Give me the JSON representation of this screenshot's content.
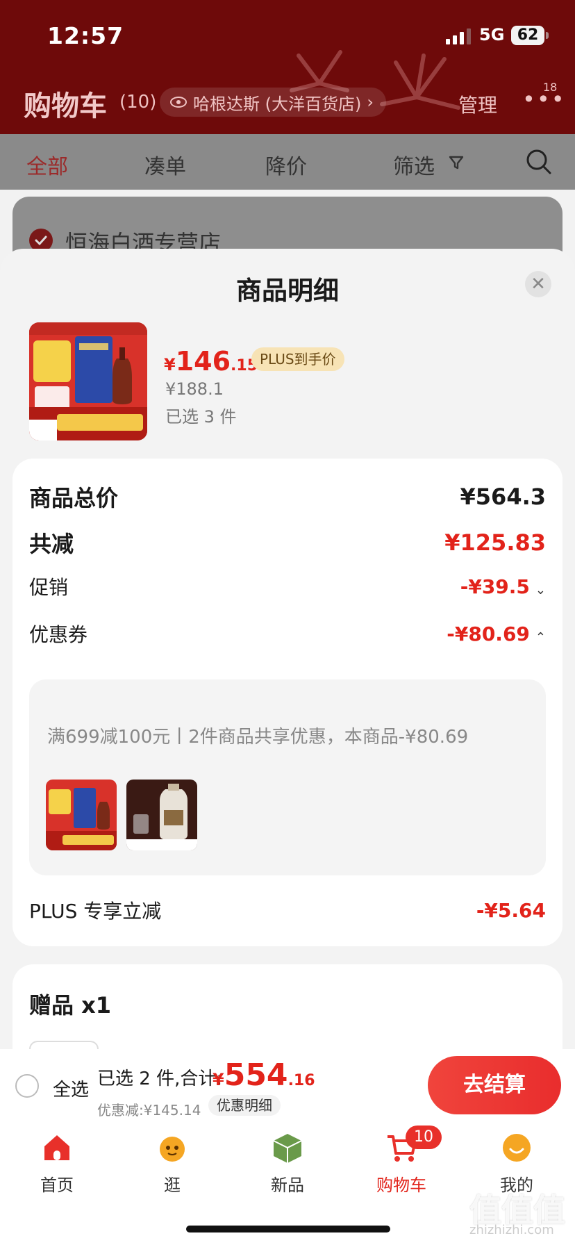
{
  "status_bar": {
    "time": "12:57",
    "network": "5G",
    "battery": "62"
  },
  "cart_header": {
    "title": "购物车",
    "count": "(10)",
    "address": "哈根达斯 (大洋百货店)",
    "manage": "管理",
    "more_badge": "18"
  },
  "filters": {
    "all": "全部",
    "bundle": "凑单",
    "price_drop": "降价",
    "filter": "筛选"
  },
  "store": {
    "name": "恒海白酒专营店"
  },
  "sheet": {
    "title": "商品明细",
    "product": {
      "price_symbol": "¥",
      "price_int": "146",
      "price_dec": ".15",
      "plus_tag": "PLUS到手价",
      "original_price": "¥188.1",
      "selected": "已选 3 件"
    },
    "details": {
      "total_label": "商品总价",
      "total_value": "¥564.3",
      "reduce_label": "共减",
      "reduce_value": "¥125.83",
      "promo_label": "促销",
      "promo_value": "-¥39.5",
      "coupon_label": "优惠券",
      "coupon_value": "-¥80.69",
      "coupon_desc": "满699减100元丨2件商品共享优惠，本商品-¥80.69",
      "plus_label": "PLUS 专享立减",
      "plus_value": "-¥5.64"
    },
    "gift": {
      "title": "赠品 x1"
    }
  },
  "checkout": {
    "select_all": "全选",
    "summary": "已选 2 件,合计:",
    "total_symbol": "¥",
    "total_int": "554",
    "total_dec": ".16",
    "discount": "优惠减:¥145.14",
    "detail_link": "优惠明细",
    "button": "去结算"
  },
  "tabs": [
    {
      "label": "首页",
      "icon": "home-icon"
    },
    {
      "label": "逛",
      "icon": "stroll-icon"
    },
    {
      "label": "新品",
      "icon": "new-product-icon"
    },
    {
      "label": "购物车",
      "icon": "cart-icon",
      "badge": "10"
    },
    {
      "label": "我的",
      "icon": "profile-icon"
    }
  ],
  "watermark": {
    "main": "值值值",
    "sub": "zhizhizhi.com"
  },
  "colors": {
    "accent": "#e2231a",
    "header_bg": "#6e0a0a",
    "plus_tag_bg": "#f7e3b5"
  }
}
